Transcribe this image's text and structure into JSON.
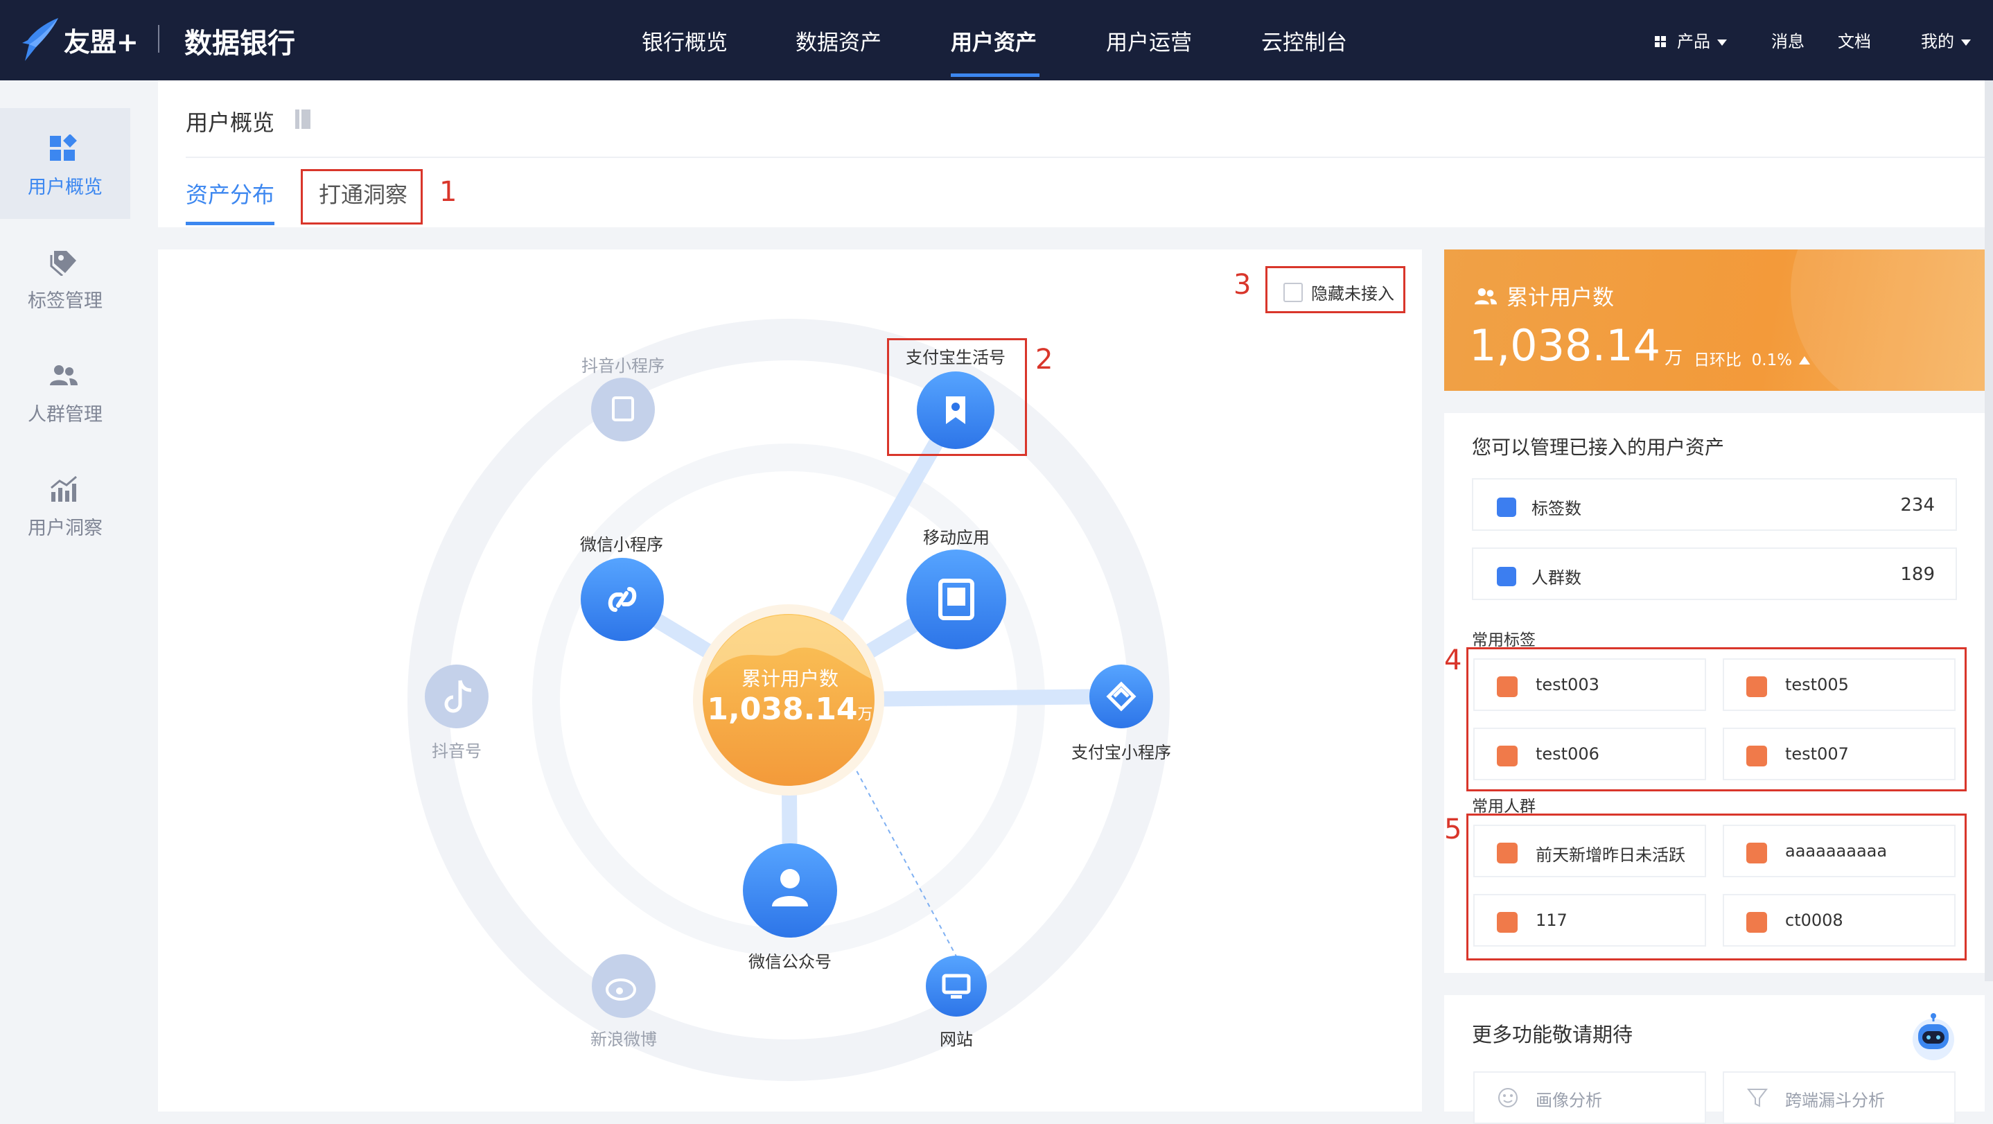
{
  "header": {
    "brand": "友盟+",
    "product": "数据银行",
    "nav": [
      "银行概览",
      "数据资产",
      "用户资产",
      "用户运营",
      "云控制台"
    ],
    "active_nav": "用户资产",
    "right": {
      "products": "产品",
      "messages": "消息",
      "docs": "文档",
      "mine": "我的"
    }
  },
  "sidebar": {
    "items": [
      {
        "label": "用户概览",
        "icon": "dashboard-icon",
        "active": true
      },
      {
        "label": "标签管理",
        "icon": "tag-icon",
        "active": false
      },
      {
        "label": "人群管理",
        "icon": "users-icon",
        "active": false
      },
      {
        "label": "用户洞察",
        "icon": "chart-icon",
        "active": false
      }
    ]
  },
  "page": {
    "title": "用户概览",
    "tabs": [
      {
        "label": "资产分布",
        "active": true
      },
      {
        "label": "打通洞察",
        "active": false
      }
    ]
  },
  "annotations": [
    "1",
    "2",
    "3",
    "4",
    "5"
  ],
  "graph": {
    "hide_unconnected_label": "隐藏未接入",
    "hide_unconnected_checked": false,
    "center": {
      "title": "累计用户数",
      "value": "1,038.14",
      "unit": "万"
    },
    "nodes": {
      "douyin_mini": {
        "label": "抖音小程序",
        "connected": false
      },
      "alipay_life": {
        "label": "支付宝生活号",
        "connected": true
      },
      "wechat_mini": {
        "label": "微信小程序",
        "connected": true
      },
      "mobile_app": {
        "label": "移动应用",
        "connected": true
      },
      "douyin": {
        "label": "抖音号",
        "connected": false
      },
      "alipay_mini": {
        "label": "支付宝小程序",
        "connected": true
      },
      "wechat_official": {
        "label": "微信公众号",
        "connected": true
      },
      "weibo": {
        "label": "新浪微博",
        "connected": false
      },
      "website": {
        "label": "网站",
        "connected": true
      }
    }
  },
  "stats": {
    "title": "累计用户数",
    "value": "1,038.14",
    "unit": "万",
    "change_label": "日环比",
    "change_value": "0.1%",
    "accent": "#f39a3a"
  },
  "assets": {
    "title": "您可以管理已接入的用户资产",
    "counts": [
      {
        "label": "标签数",
        "value": "234"
      },
      {
        "label": "人群数",
        "value": "189"
      }
    ],
    "common_tags_label": "常用标签",
    "common_tags": [
      "test003",
      "test005",
      "test006",
      "test007"
    ],
    "common_groups_label": "常用人群",
    "common_groups": [
      "前天新增昨日未活跃",
      "aaaaaaaaaa",
      "117",
      "ct0008"
    ]
  },
  "more": {
    "title": "更多功能敬请期待",
    "items": [
      "画像分析",
      "跨端漏斗分析"
    ]
  },
  "colors": {
    "nav_bg": "#18203a",
    "primary": "#3c87f0",
    "annotation": "#d9362b",
    "tag_icon": "#f07a4a"
  }
}
